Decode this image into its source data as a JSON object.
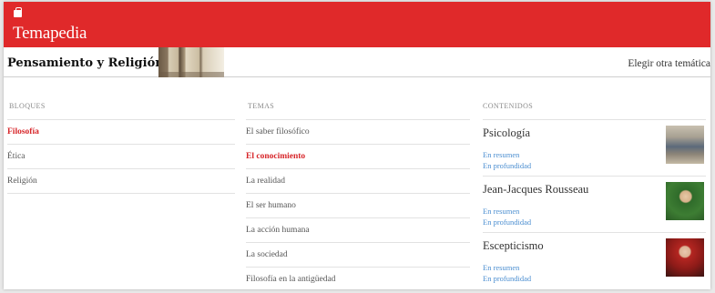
{
  "brand": {
    "name": "Temapedia",
    "icon": "briefcase-icon"
  },
  "header": {
    "section_title": "Pensamiento y Religión",
    "choose_label": "Elegir otra temática"
  },
  "columns": {
    "bloques": {
      "heading": "BLOQUES",
      "items": [
        "Filosofía",
        "Ética",
        "Religión"
      ],
      "active": "Filosofía"
    },
    "temas": {
      "heading": "TEMAS",
      "items": [
        "El saber filosófico",
        "El conocimiento",
        "La realidad",
        "El ser humano",
        "La acción humana",
        "La sociedad",
        "Filosofía en la antigüedad"
      ],
      "active": "El conocimiento"
    },
    "contenidos": {
      "heading": "CONTENIDOS",
      "items": [
        {
          "title": "Psicología",
          "link1": "En resumen",
          "link2": "En profundidad"
        },
        {
          "title": "Jean-Jacques Rousseau",
          "link1": "En resumen",
          "link2": "En profundidad"
        },
        {
          "title": "Escepticismo",
          "link1": "En resumen",
          "link2": "En profundidad"
        }
      ]
    }
  },
  "colors": {
    "brand_red": "#e0292a",
    "active_red": "#d7262a",
    "link_blue": "#4c8fd1"
  }
}
